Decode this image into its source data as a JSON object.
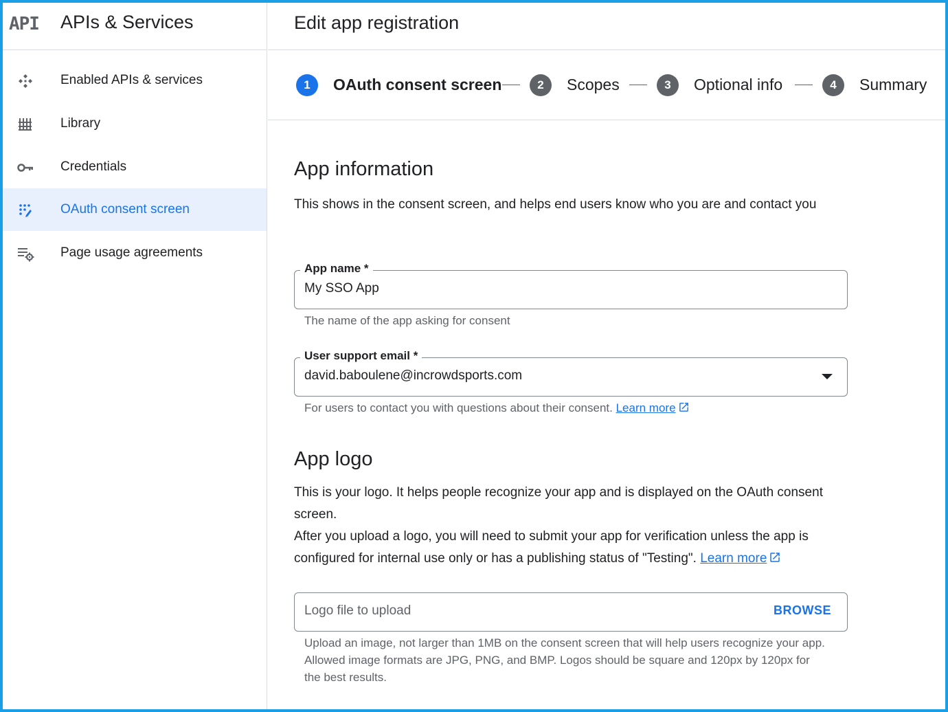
{
  "sidebar": {
    "logo_text": "API",
    "title": "APIs & Services",
    "items": [
      {
        "label": "Enabled APIs & services",
        "icon": "enabled-apis-icon",
        "active": false
      },
      {
        "label": "Library",
        "icon": "library-icon",
        "active": false
      },
      {
        "label": "Credentials",
        "icon": "key-icon",
        "active": false
      },
      {
        "label": "OAuth consent screen",
        "icon": "consent-screen-icon",
        "active": true
      },
      {
        "label": "Page usage agreements",
        "icon": "settings-list-icon",
        "active": false
      }
    ]
  },
  "header": {
    "title": "Edit app registration"
  },
  "stepper": {
    "steps": [
      {
        "number": "1",
        "label": "OAuth consent screen",
        "active": true
      },
      {
        "number": "2",
        "label": "Scopes",
        "active": false
      },
      {
        "number": "3",
        "label": "Optional info",
        "active": false
      },
      {
        "number": "4",
        "label": "Summary",
        "active": false
      }
    ]
  },
  "app_info": {
    "title": "App information",
    "description": "This shows in the consent screen, and helps end users know who you are and contact you",
    "app_name": {
      "label": "App name *",
      "value": "My SSO App",
      "helper": "The name of the app asking for consent"
    },
    "support_email": {
      "label": "User support email *",
      "value": "david.baboulene@incrowdsports.com",
      "helper": "For users to contact you with questions about their consent.",
      "link": "Learn more"
    }
  },
  "app_logo": {
    "title": "App logo",
    "description1": "This is your logo. It helps people recognize your app and is displayed on the OAuth consent screen.",
    "description2": "After you upload a logo, you will need to submit your app for verification unless the app is configured for internal use only or has a publishing status of \"Testing\".",
    "link": "Learn more",
    "upload_placeholder": "Logo file to upload",
    "browse_label": "BROWSE",
    "helper": "Upload an image, not larger than 1MB on the consent screen that will help users recognize your app. Allowed image formats are JPG, PNG, and BMP. Logos should be square and 120px by 120px for the best results."
  },
  "colors": {
    "accent": "#1a73e8",
    "active_bg": "#e8f0fe",
    "frame": "#1a9ee6"
  }
}
